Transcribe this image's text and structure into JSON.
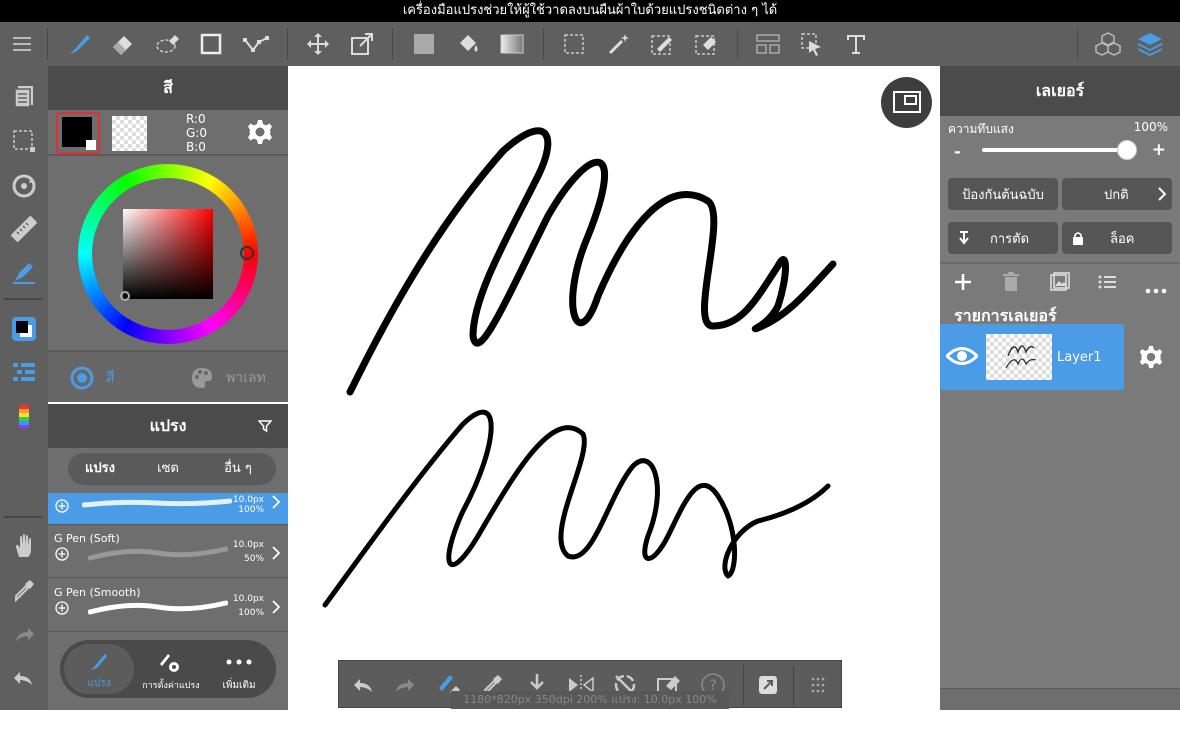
{
  "banner": {
    "text": "เครื่องมือแปรงช่วยให้ผู้ใช้วาดลงบนผืนผ้าใบด้วยแปรงชนิดต่าง ๆ ได้"
  },
  "colorPanel": {
    "title": "สี",
    "r": "R:0",
    "g": "G:0",
    "b": "B:0",
    "mainColor": "#000000",
    "tabs": {
      "color": "สี",
      "palette": "พาเลท"
    }
  },
  "brushPanel": {
    "title": "แปรง",
    "tabs": [
      "แปรง",
      "เซต",
      "อื่น ๆ"
    ],
    "items": [
      {
        "name": "",
        "size": "10.0px",
        "opacity": "100%"
      },
      {
        "name": "G Pen (Soft)",
        "size": "10.0px",
        "opacity": "50%"
      },
      {
        "name": "G Pen (Smooth)",
        "size": "10.0px",
        "opacity": "100%"
      }
    ],
    "bottom": {
      "brush": "แปรง",
      "settings": "การตั้งค่าแปรง",
      "more": "เพิ่มเติม"
    }
  },
  "layerPanel": {
    "title": "เลเยอร์",
    "opacityLabel": "ความทึบแสง",
    "opacityValue": "100%",
    "opacity": 1.0,
    "protectLabel": "ป้องกันต้นฉบับ",
    "blendMode": "ปกติ",
    "clipLabel": "การตัด",
    "lockLabel": "ล็อค",
    "listTitle": "รายการเลเยอร์",
    "layers": [
      {
        "name": "Layer1"
      }
    ]
  },
  "statusBar": {
    "text": "1180*820px 350dpi 200% แปรง: 10.0px 100%"
  },
  "colors": {
    "accent": "#4a9ce6",
    "panelDark": "#4b4b4b",
    "toolbar": "#5f5f5f",
    "selectedRed": "#e03030"
  }
}
